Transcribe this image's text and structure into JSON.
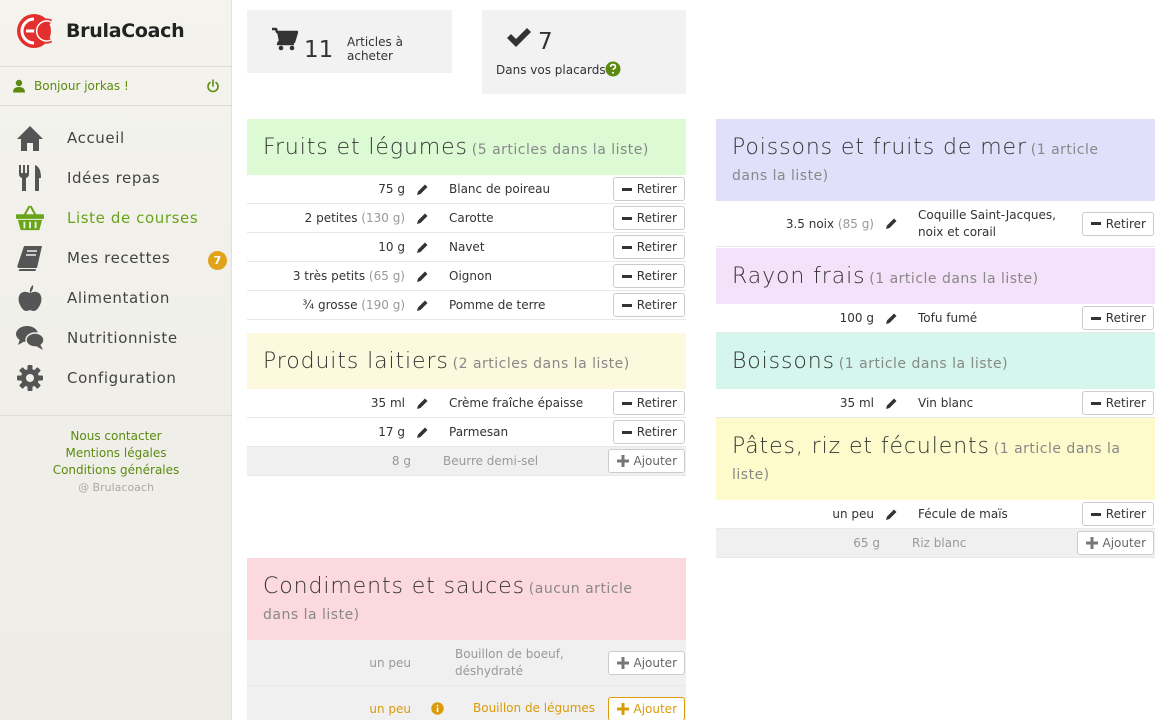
{
  "app": {
    "name": "BrulaCoach"
  },
  "user": {
    "greeting": "Bonjour jorkas !"
  },
  "nav": {
    "items": [
      {
        "label": "Accueil",
        "icon": "home-icon"
      },
      {
        "label": "Idées repas",
        "icon": "cutlery-icon"
      },
      {
        "label": "Liste de courses",
        "icon": "basket-icon",
        "active": true
      },
      {
        "label": "Mes recettes",
        "icon": "book-icon"
      },
      {
        "label": "Alimentation",
        "icon": "apple-icon"
      },
      {
        "label": "Nutritionniste",
        "icon": "chat-icon"
      },
      {
        "label": "Configuration",
        "icon": "gear-icon",
        "badge": "7"
      }
    ]
  },
  "footer": {
    "contact": "Nous contacter",
    "legal": "Mentions légales",
    "terms": "Conditions générales",
    "copyright": "@ Brulacoach"
  },
  "stats": {
    "to_buy": {
      "count": "11",
      "label": "Articles à acheter"
    },
    "in_pantry": {
      "count": "7",
      "label": "Dans vos placards"
    }
  },
  "buttons": {
    "remove": "Retirer",
    "add": "Ajouter"
  },
  "sections": {
    "fruits": {
      "title": "Fruits et légumes",
      "count": "(5 articles dans la liste)",
      "rows": [
        {
          "qty": "75 g",
          "grams": "",
          "name": "Blanc de poireau"
        },
        {
          "qty": "2 petites",
          "grams": "(130 g)",
          "name": "Carotte"
        },
        {
          "qty": "10 g",
          "grams": "",
          "name": "Navet"
        },
        {
          "qty": "3 très petits",
          "grams": "(65 g)",
          "name": "Oignon"
        },
        {
          "qty": "¾ grosse",
          "grams": "(190 g)",
          "name": "Pomme de terre"
        }
      ]
    },
    "laitiers": {
      "title": "Produits laitiers",
      "count": "(2 articles dans la liste)",
      "rows": [
        {
          "qty": "35 ml",
          "grams": "",
          "name": "Crème fraîche épaisse"
        },
        {
          "qty": "17 g",
          "grams": "",
          "name": "Parmesan"
        }
      ],
      "absent": [
        {
          "qty": "8 g",
          "name": "Beurre demi-sel"
        }
      ]
    },
    "condiments": {
      "title": "Condiments et sauces",
      "count": "(aucun article dans la liste)",
      "absent": [
        {
          "qty": "un peu",
          "name": "Bouillon de boeuf, déshydraté"
        },
        {
          "qty": "un peu",
          "name": "Bouillon de légumes"
        }
      ]
    },
    "poissons": {
      "title": "Poissons et fruits de mer",
      "count": "(1 article dans la liste)",
      "rows": [
        {
          "qty": "3.5 noix",
          "grams": "(85 g)",
          "name": "Coquille Saint-Jacques, noix et corail"
        }
      ]
    },
    "frais": {
      "title": "Rayon frais",
      "count": "(1 article dans la liste)",
      "rows": [
        {
          "qty": "100 g",
          "grams": "",
          "name": "Tofu fumé"
        }
      ]
    },
    "boissons": {
      "title": "Boissons",
      "count": "(1 article dans la liste)",
      "rows": [
        {
          "qty": "35 ml",
          "grams": "",
          "name": "Vin blanc"
        }
      ]
    },
    "pates": {
      "title": "Pâtes, riz et féculents",
      "count": "(1 article dans la liste)",
      "rows": [
        {
          "qty": "un peu",
          "grams": "",
          "name": "Fécule de maïs"
        }
      ],
      "absent": [
        {
          "qty": "65 g",
          "name": "Riz blanc"
        }
      ]
    }
  },
  "colors": {
    "accent": "#6aa41b",
    "brand_red": "#e2302f",
    "badge": "#e0a21a"
  }
}
